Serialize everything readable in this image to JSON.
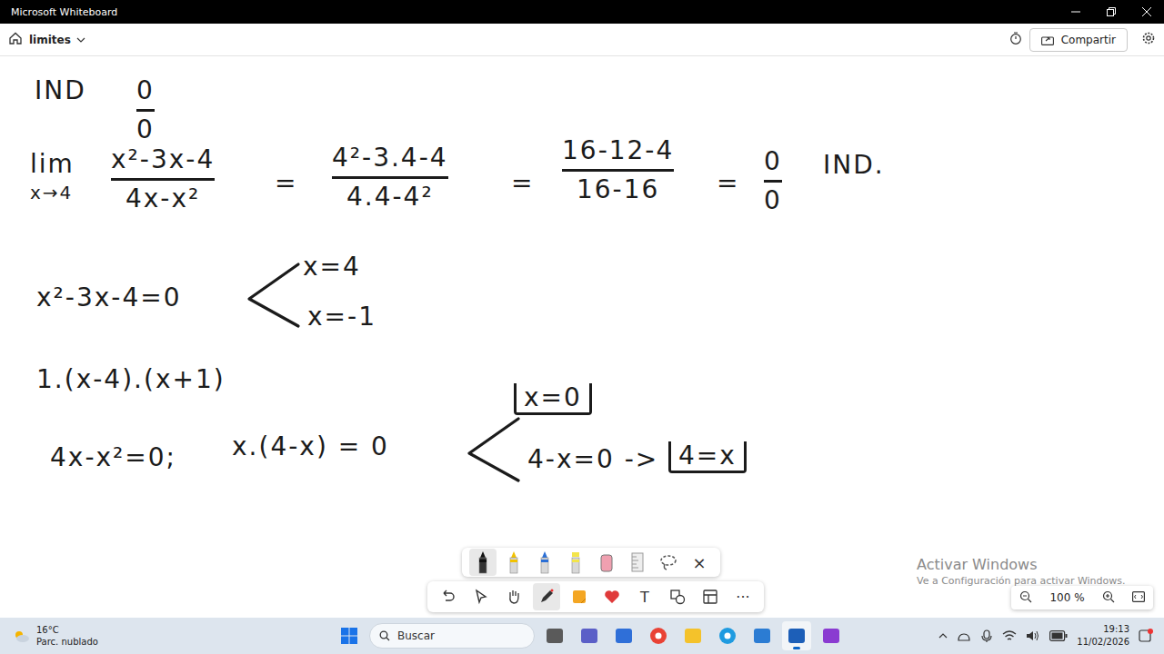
{
  "window": {
    "title": "Microsoft Whiteboard"
  },
  "header": {
    "board_name": "limites",
    "share_button": "Compartir"
  },
  "canvas": {
    "items": [
      {
        "kind": "text",
        "text": "IND"
      },
      {
        "kind": "fraction",
        "num": "0",
        "den": "0"
      },
      {
        "kind": "limit",
        "word": "lim",
        "sub": "x→4"
      },
      {
        "kind": "fraction",
        "num": "x²-3x-4",
        "den": "4x-x²"
      },
      {
        "kind": "text",
        "text": "="
      },
      {
        "kind": "fraction",
        "num": "4²-3.4-4",
        "den": "4.4-4²"
      },
      {
        "kind": "text",
        "text": "="
      },
      {
        "kind": "fraction",
        "num": "16-12-4",
        "den": "16-16"
      },
      {
        "kind": "text",
        "text": "="
      },
      {
        "kind": "fraction",
        "num": "0",
        "den": "0"
      },
      {
        "kind": "text",
        "text": "IND."
      },
      {
        "kind": "text",
        "text": "x²-3x-4=0"
      },
      {
        "kind": "branch"
      },
      {
        "kind": "text",
        "text": "x=4"
      },
      {
        "kind": "text",
        "text": "x=-1"
      },
      {
        "kind": "text",
        "text": "1.(x-4).(x+1)"
      },
      {
        "kind": "text",
        "text": "4x-x²=0;"
      },
      {
        "kind": "text",
        "text": "x.(4-x) = 0"
      },
      {
        "kind": "branch"
      },
      {
        "kind": "boxed",
        "text": "x=0"
      },
      {
        "kind": "text",
        "text": "4-x=0 ->"
      },
      {
        "kind": "boxed",
        "text": "4=x"
      }
    ]
  },
  "pen_toolbar": {
    "tools": [
      {
        "kind": "marker",
        "color": "#111111",
        "selected": true
      },
      {
        "kind": "pencil",
        "color": "#f2c200",
        "selected": false
      },
      {
        "kind": "pen",
        "color": "#2a6fd6",
        "selected": false
      },
      {
        "kind": "highlighter",
        "color": "#f3e54a",
        "selected": false
      },
      {
        "kind": "eraser",
        "color": "#f0a0b0",
        "selected": false
      },
      {
        "kind": "ruler",
        "color": "#9a9a9a",
        "selected": false
      },
      {
        "kind": "lasso",
        "color": "#555555",
        "selected": false
      }
    ],
    "close": "×"
  },
  "main_toolbar": {
    "tools": [
      {
        "kind": "undo",
        "selected": false
      },
      {
        "kind": "select",
        "selected": false
      },
      {
        "kind": "hand",
        "selected": false
      },
      {
        "kind": "inking",
        "selected": true
      },
      {
        "kind": "note",
        "selected": false
      },
      {
        "kind": "reaction",
        "selected": false
      },
      {
        "kind": "text",
        "label": "T",
        "selected": false
      },
      {
        "kind": "shapes",
        "selected": false
      },
      {
        "kind": "templates",
        "selected": false
      },
      {
        "kind": "more",
        "label": "···",
        "selected": false
      }
    ]
  },
  "zoom": {
    "level": "100 %"
  },
  "watermark": {
    "title": "Activar Windows",
    "subtitle": "Ve a Configuración para activar Windows."
  },
  "taskbar": {
    "weather": {
      "temp": "16°C",
      "condition": "Parc. nublado"
    },
    "search": {
      "placeholder": "Buscar"
    },
    "apps": [
      {
        "kind": "files",
        "selected": false
      },
      {
        "kind": "teams",
        "selected": false
      },
      {
        "kind": "store",
        "selected": false
      },
      {
        "kind": "chrome",
        "selected": false
      },
      {
        "kind": "explorer",
        "selected": false
      },
      {
        "kind": "edge",
        "selected": false
      },
      {
        "kind": "todo",
        "selected": false
      },
      {
        "kind": "whiteboard",
        "selected": true
      },
      {
        "kind": "other",
        "selected": false
      }
    ],
    "time": "19:13",
    "date": "11/02/2026"
  }
}
